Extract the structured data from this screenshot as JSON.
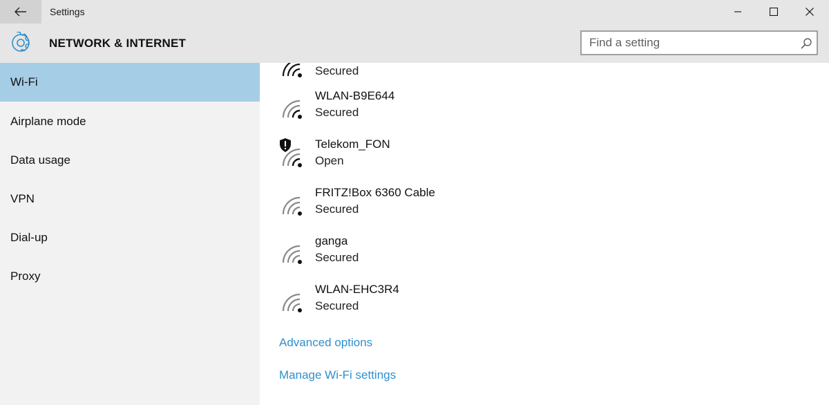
{
  "window": {
    "title": "Settings"
  },
  "header": {
    "section_title": "NETWORK & INTERNET",
    "search_placeholder": "Find a setting"
  },
  "sidebar": {
    "items": [
      {
        "label": "Wi-Fi",
        "active": true
      },
      {
        "label": "Airplane mode",
        "active": false
      },
      {
        "label": "Data usage",
        "active": false
      },
      {
        "label": "VPN",
        "active": false
      },
      {
        "label": "Dial-up",
        "active": false
      },
      {
        "label": "Proxy",
        "active": false
      }
    ]
  },
  "networks": {
    "partial": {
      "status": "Secured"
    },
    "items": [
      {
        "name": "WLAN-B9E644",
        "status": "Secured",
        "signal_bars": 4,
        "shield_warning": false
      },
      {
        "name": "Telekom_FON",
        "status": "Open",
        "signal_bars": 4,
        "shield_warning": true
      },
      {
        "name": "FRITZ!Box 6360 Cable",
        "status": "Secured",
        "signal_bars": 0,
        "shield_warning": false
      },
      {
        "name": "ganga",
        "status": "Secured",
        "signal_bars": 0,
        "shield_warning": false
      },
      {
        "name": "WLAN-EHC3R4",
        "status": "Secured",
        "signal_bars": 0,
        "shield_warning": false
      }
    ]
  },
  "links": {
    "advanced_options": "Advanced options",
    "manage_wifi": "Manage Wi-Fi settings"
  },
  "colors": {
    "accent_link": "#2f8fce",
    "selected_nav": "#a6cde6",
    "chrome_background": "#e6e6e6",
    "sidebar_background": "#f2f2f2"
  },
  "icons": {
    "back": "back-arrow-icon",
    "minimize": "minimize-icon",
    "maximize": "maximize-icon",
    "close": "close-icon",
    "settings": "gear-icon",
    "search": "search-icon",
    "wifi": "wifi-signal-icon",
    "shield": "shield-warning-icon"
  }
}
